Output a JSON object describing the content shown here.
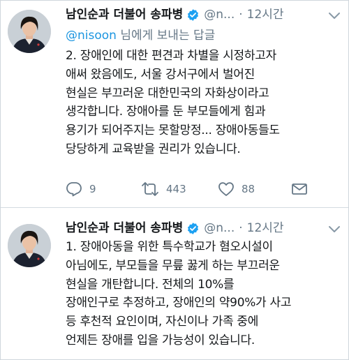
{
  "tweets": [
    {
      "author_name": "남인순과 더불어 송파병",
      "handle": "@n...",
      "separator": "·",
      "time": "12시간",
      "reply_to": {
        "mention": "@nisoon",
        "suffix": " 님에게 보내는 답글"
      },
      "lines": [
        "2. 장애인에 대한 편견과 차별을 시정하고자",
        "애써 왔음에도, 서울 강서구에서 벌어진",
        "현실은 부끄러운 대한민국의 자화상이라고",
        "생각합니다. 장애아를 둔 부모들에게 힘과",
        "용기가 되어주지는 못할망정... 장애아동들도",
        "당당하게 교육받을 권리가 있습니다."
      ],
      "actions": {
        "reply_count": "9",
        "retweet_count": "443",
        "like_count": "88"
      }
    },
    {
      "author_name": "남인순과 더불어 송파병",
      "handle": "@n...",
      "separator": "·",
      "time": "12시간",
      "lines": [
        "1. 장애아동을 위한 특수학교가 혐오시설이",
        "아님에도, 부모들을 무릎 꿇게 하는 부끄러운",
        "현실을 개탄합니다. 전체의 10%를",
        "장애인구로 추정하고, 장애인의 약90%가 사고",
        "등 후천적 요인이며, 자신이나 가족 중에",
        "언제든 장애를 입을 가능성이 있습니다."
      ]
    }
  ],
  "icons": {
    "verified": "verified-badge-icon",
    "more": "chevron-down-icon",
    "reply": "reply-icon",
    "retweet": "retweet-icon",
    "like": "heart-icon",
    "dm": "envelope-icon"
  },
  "colors": {
    "verified_blue": "#1da1f2",
    "link_blue": "#1b95e0",
    "secondary_text": "#657786",
    "primary_text": "#14171a"
  }
}
